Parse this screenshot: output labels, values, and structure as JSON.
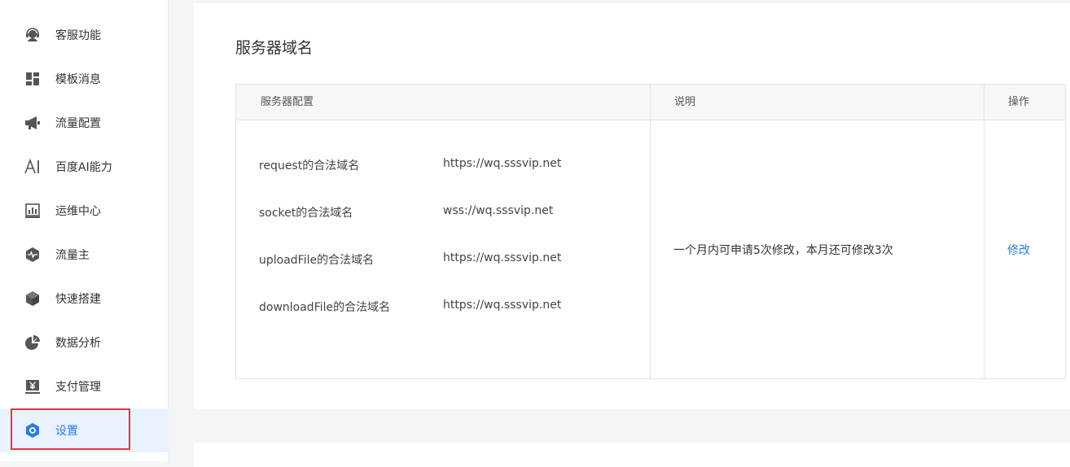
{
  "sidebar": {
    "items": [
      {
        "label": "客服功能",
        "icon": "headset-icon"
      },
      {
        "label": "模板消息",
        "icon": "template-grid-icon"
      },
      {
        "label": "流量配置",
        "icon": "megaphone-icon"
      },
      {
        "label": "百度AI能力",
        "icon": "ai-icon"
      },
      {
        "label": "运维中心",
        "icon": "bar-chart-icon"
      },
      {
        "label": "流量主",
        "icon": "pulse-hexagon-icon"
      },
      {
        "label": "快速搭建",
        "icon": "cube-icon"
      },
      {
        "label": "数据分析",
        "icon": "pie-chart-icon"
      },
      {
        "label": "支付管理",
        "icon": "yen-icon"
      },
      {
        "label": "设置",
        "icon": "settings-hexagon-icon",
        "active": true
      }
    ]
  },
  "main": {
    "title": "服务器域名",
    "table": {
      "headers": [
        "服务器配置",
        "说明",
        "操作"
      ],
      "rows": [
        {
          "label": "request的合法域名",
          "value": "https://wq.sssvip.net"
        },
        {
          "label": "socket的合法域名",
          "value": "wss://wq.sssvip.net"
        },
        {
          "label": "uploadFile的合法域名",
          "value": "https://wq.sssvip.net"
        },
        {
          "label": "downloadFile的合法域名",
          "value": "https://wq.sssvip.net"
        }
      ],
      "description": "一个月内可申请5次修改，本月还可修改3次",
      "action": "修改"
    }
  },
  "colors": {
    "accent": "#2a7ae2",
    "active_bg": "#eaf2ff",
    "highlight": "#e53935",
    "icon": "#555555"
  }
}
